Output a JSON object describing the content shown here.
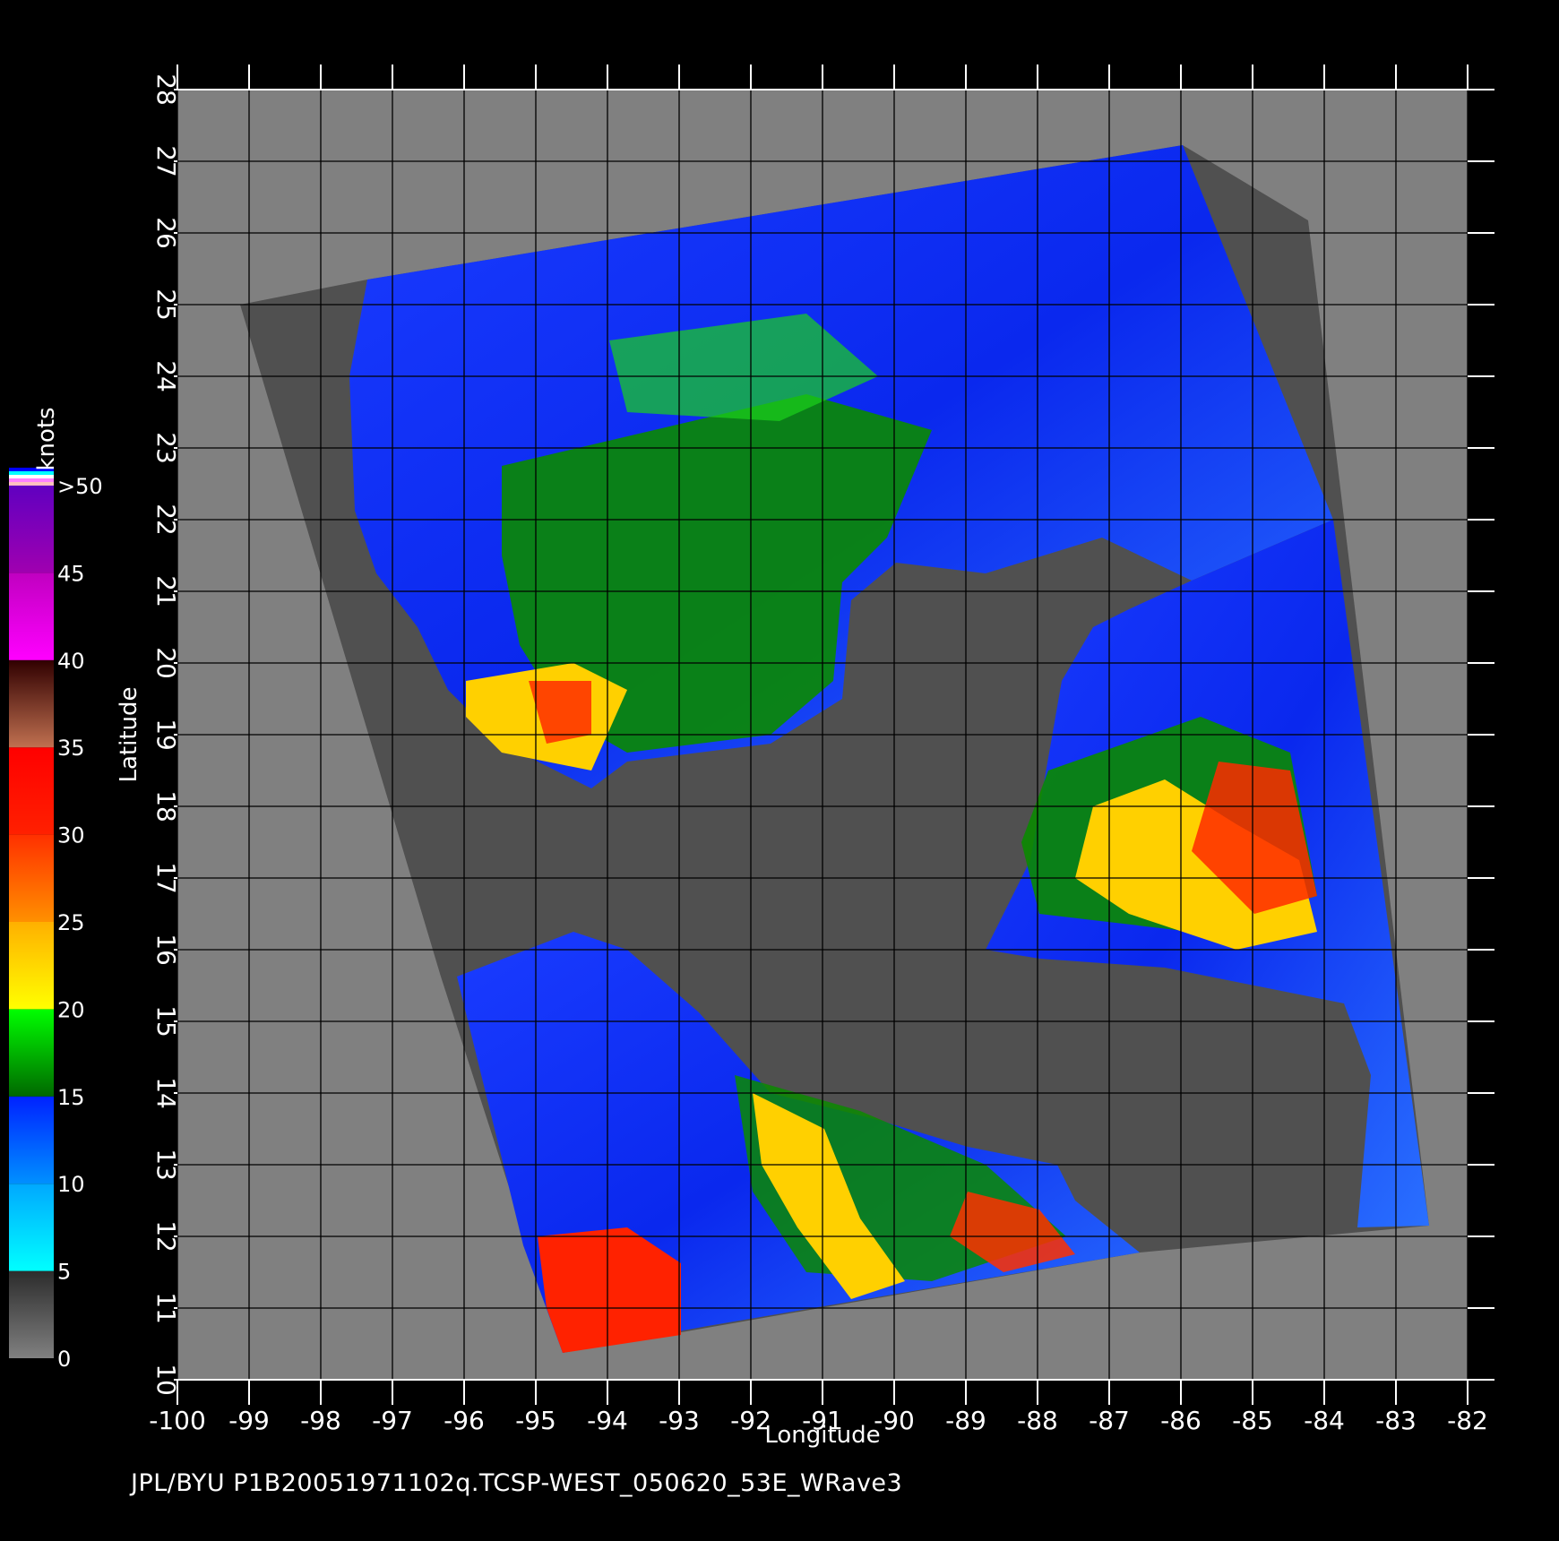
{
  "map": {
    "x_axis": {
      "title": "Longitude",
      "ticks": [
        "-100",
        "-99",
        "-98",
        "-97",
        "-96",
        "-95",
        "-94",
        "-93",
        "-92",
        "-91",
        "-90",
        "-89",
        "-88",
        "-87",
        "-86",
        "-85",
        "-84",
        "-83",
        "-82"
      ],
      "range": [
        -100,
        -82
      ]
    },
    "y_axis": {
      "title": "Latitude",
      "ticks": [
        "10",
        "11",
        "12",
        "13",
        "14",
        "15",
        "16",
        "17",
        "18",
        "19",
        "20",
        "21",
        "22",
        "23",
        "24",
        "25",
        "26",
        "27",
        "28"
      ],
      "range": [
        10,
        28
      ]
    },
    "colorbar": {
      "unit": "knots",
      "labels": [
        "0",
        "5",
        "10",
        "15",
        "20",
        "25",
        "30",
        "35",
        "40",
        "45",
        ">50"
      ],
      "bands": [
        {
          "from": 0,
          "to": 5,
          "colors": [
            "#808080",
            "#2c2c2c"
          ]
        },
        {
          "from": 5,
          "to": 10,
          "colors": [
            "#00ffff",
            "#00a8ff"
          ]
        },
        {
          "from": 10,
          "to": 15,
          "colors": [
            "#0090ff",
            "#0022ff"
          ]
        },
        {
          "from": 15,
          "to": 20,
          "colors": [
            "#006800",
            "#00ff00"
          ]
        },
        {
          "from": 20,
          "to": 25,
          "colors": [
            "#ffff00",
            "#ffb000"
          ]
        },
        {
          "from": 25,
          "to": 30,
          "colors": [
            "#ff9000",
            "#ff3000"
          ]
        },
        {
          "from": 30,
          "to": 35,
          "colors": [
            "#ff2000",
            "#ff0000"
          ]
        },
        {
          "from": 35,
          "to": 40,
          "colors": [
            "#c07050",
            "#300000"
          ]
        },
        {
          "from": 40,
          "to": 45,
          "colors": [
            "#ff00ff",
            "#c000c0"
          ]
        },
        {
          "from": 45,
          "to": 50,
          "colors": [
            "#a000b0",
            "#6000c0"
          ]
        }
      ],
      "top_stripes": [
        "#ffc0c0",
        "#ff80ff",
        "#ffffff",
        "#00ffff",
        "#0000ff"
      ]
    },
    "colors": {
      "background": "#000000",
      "land": "#808080",
      "swath_nodata": "#505050",
      "gridline": "#000000",
      "axis": "#ffffff"
    }
  },
  "footer": {
    "text": "JPL/BYU  P1B20051971102q.TCSP-WEST_050620_53E_WRave3"
  }
}
